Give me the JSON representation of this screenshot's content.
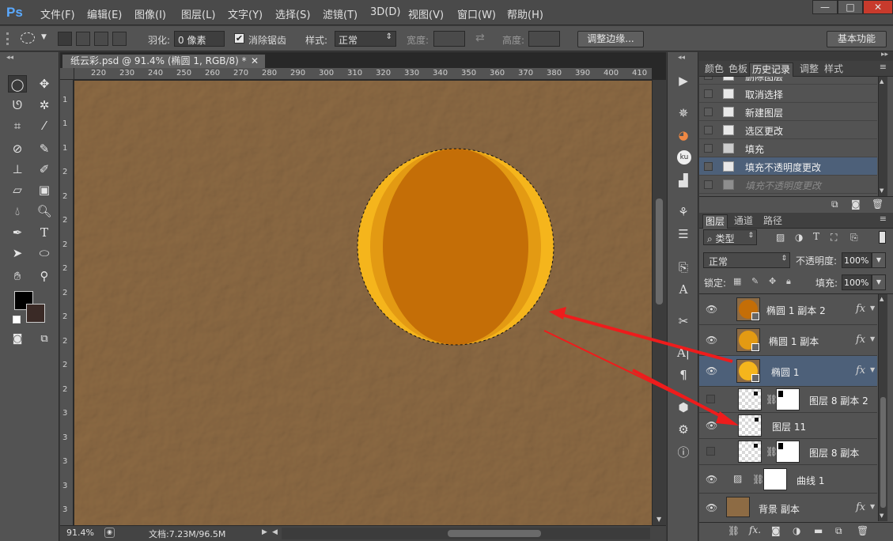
{
  "app": {
    "logo": "Ps"
  },
  "menu": [
    "文件(F)",
    "编辑(E)",
    "图像(I)",
    "图层(L)",
    "文字(Y)",
    "选择(S)",
    "滤镜(T)",
    "3D(D)",
    "视图(V)",
    "窗口(W)",
    "帮助(H)"
  ],
  "window_buttons": [
    "—",
    "□",
    "✕"
  ],
  "options": {
    "feather_label": "羽化:",
    "feather_value": "0 像素",
    "antialias_label": "消除锯齿",
    "style_label": "样式:",
    "style_value": "正常",
    "width_label": "宽度:",
    "height_label": "高度:",
    "refine_edge": "调整边缘...",
    "workspace": "基本功能"
  },
  "document": {
    "tab_title": "纸云彩.psd @ 91.4% (椭圆 1, RGB/8) *",
    "close": "✕",
    "ruler_h": [
      "220",
      "230",
      "240",
      "250",
      "260",
      "270",
      "280",
      "290",
      "300",
      "310",
      "320",
      "330",
      "340",
      "350",
      "360",
      "370",
      "380",
      "390",
      "400",
      "410"
    ],
    "ruler_v": [
      "1",
      "1",
      "1",
      "2",
      "2",
      "2",
      "2",
      "2",
      "2",
      "2",
      "2",
      "2",
      "2",
      "3",
      "3",
      "3",
      "3",
      "3"
    ],
    "zoom": "91.4%",
    "doc_size": "文档:7.23M/96.5M",
    "colors": {
      "canvas": "#8d6b44",
      "outer_ring": "#f5b51c",
      "mid_ring": "#e39a13",
      "inner": "#c46e07",
      "arrow": "#ee1c1c"
    }
  },
  "history": {
    "tabs": [
      "颜色",
      "色板",
      "历史记录",
      "调整",
      "样式"
    ],
    "active_tab": "历史记录",
    "items": [
      {
        "label": "删除图层",
        "state": "partial"
      },
      {
        "label": "取消选择",
        "state": "normal"
      },
      {
        "label": "新建图层",
        "state": "normal"
      },
      {
        "label": "选区更改",
        "state": "normal"
      },
      {
        "label": "填充",
        "state": "normal"
      },
      {
        "label": "填充不透明度更改",
        "state": "selected"
      },
      {
        "label": "填充不透明度更改",
        "state": "undone"
      }
    ]
  },
  "layers_panel": {
    "tabs": [
      "图层",
      "通道",
      "路径"
    ],
    "filter_label": "类型",
    "blend_mode": "正常",
    "opacity_label": "不透明度:",
    "opacity_value": "100%",
    "lock_label": "锁定:",
    "fill_label": "填充:",
    "fill_value": "100%",
    "layers": [
      {
        "name": "椭圆 1 副本 2",
        "visible": true,
        "fx": "fx",
        "thumb": "shape-dark"
      },
      {
        "name": "椭圆 1 副本",
        "visible": true,
        "fx": "fx",
        "thumb": "shape-mid"
      },
      {
        "name": "椭圆 1",
        "visible": true,
        "fx": "fx",
        "thumb": "shape-light",
        "selected": true
      },
      {
        "name": "图层 8 副本 2",
        "visible": false,
        "thumb": "masked"
      },
      {
        "name": "图层 11",
        "visible": true,
        "thumb": "transparent"
      },
      {
        "name": "图层 8 副本",
        "visible": false,
        "thumb": "masked"
      },
      {
        "name": "曲线 1",
        "visible": true,
        "thumb": "curves"
      },
      {
        "name": "背景 副本",
        "visible": true,
        "fx": "fx",
        "thumb": "brown"
      }
    ]
  }
}
